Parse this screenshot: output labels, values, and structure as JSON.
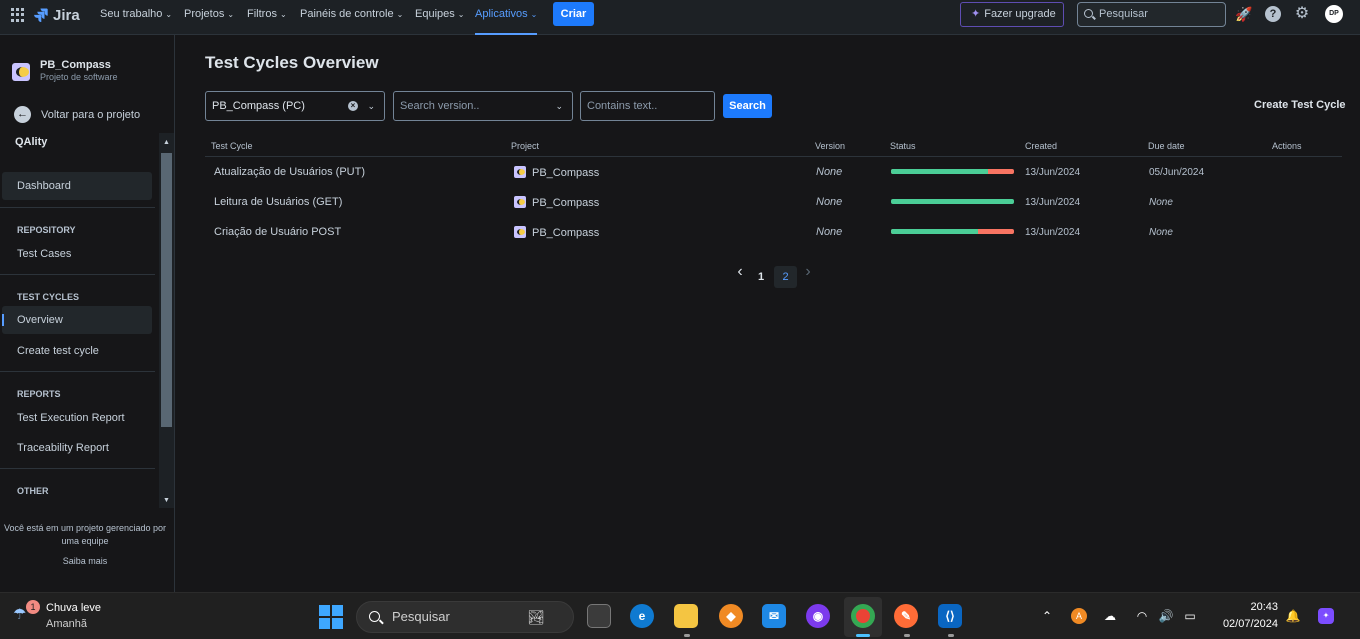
{
  "topnav": {
    "app_name": "Jira",
    "items": [
      {
        "label": "Seu trabalho"
      },
      {
        "label": "Projetos"
      },
      {
        "label": "Filtros"
      },
      {
        "label": "Painéis de controle"
      },
      {
        "label": "Equipes"
      },
      {
        "label": "Aplicativos"
      }
    ],
    "create_label": "Criar",
    "upgrade_label": "Fazer upgrade",
    "search_placeholder": "Pesquisar",
    "avatar_initials": "DP"
  },
  "sidebar": {
    "project_name": "PB_Compass",
    "project_type": "Projeto de software",
    "back_label": "Voltar para o projeto",
    "app_label": "QAlity",
    "dashboard_label": "Dashboard",
    "section_repository": "REPOSITORY",
    "test_cases_label": "Test Cases",
    "section_test_cycles": "TEST CYCLES",
    "overview_label": "Overview",
    "create_cycle_label": "Create test cycle",
    "section_reports": "REPORTS",
    "execution_report_label": "Test Execution Report",
    "traceability_label": "Traceability Report",
    "section_other": "OTHER",
    "footer_note": "Você está em um projeto gerenciado por uma equipe",
    "footer_link": "Saiba mais"
  },
  "main": {
    "title": "Test Cycles Overview",
    "project_filter_value": "PB_Compass (PC)",
    "version_placeholder": "Search version..",
    "text_placeholder": "Contains text..",
    "search_button": "Search",
    "create_button": "Create Test Cycle",
    "columns": [
      "Test Cycle",
      "Project",
      "Version",
      "Status",
      "Created",
      "Due date",
      "Actions"
    ],
    "rows": [
      {
        "name": "Atualização de Usuários (PUT)",
        "project": "PB_Compass",
        "version": "None",
        "passed_fraction": 0.79,
        "created": "13/Jun/2024",
        "due": "05/Jun/2024"
      },
      {
        "name": "Leitura de Usuários (GET)",
        "project": "PB_Compass",
        "version": "None",
        "passed_fraction": 1.0,
        "created": "13/Jun/2024",
        "due": "None"
      },
      {
        "name": "Criação de Usuário POST",
        "project": "PB_Compass",
        "version": "None",
        "passed_fraction": 0.71,
        "created": "13/Jun/2024",
        "due": "None"
      }
    ],
    "pagination": {
      "prev": "‹",
      "page1": "1",
      "page2": "2",
      "next": "›"
    }
  },
  "taskbar": {
    "weather_badge": "1",
    "weather_title": "Chuva leve",
    "weather_subtitle": "Amanhã",
    "search_label": "Pesquisar",
    "time": "20:43",
    "date": "02/07/2024"
  },
  "colors": {
    "accent": "#1d7afc",
    "pass": "#4bce97",
    "fail": "#f87462"
  }
}
